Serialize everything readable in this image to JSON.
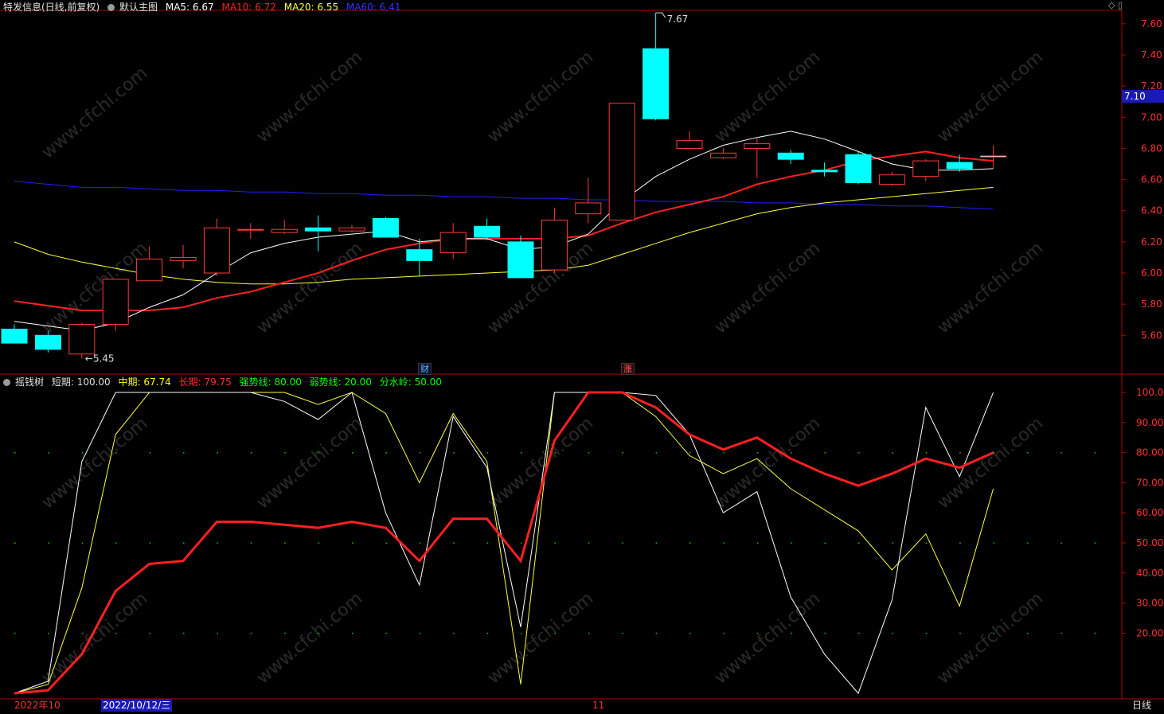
{
  "header": {
    "stock_title": "特发信息(日线,前复权)",
    "template": "默认主图",
    "ma5": "MA5: 6.67",
    "ma10": "MA10: 6.72",
    "ma20": "MA20: 6.55",
    "ma60": "MA60: 6.41"
  },
  "indicator_header": {
    "name": "摇钱树",
    "short": "短期: 100.00",
    "mid": "中期: 67.74",
    "long": "长期: 79.75",
    "strong": "强势线: 80.00",
    "weak": "弱势线: 20.00",
    "watershed": "分水岭: 50.00"
  },
  "annotations": {
    "high_label": "7.67",
    "low_label": "←5.45",
    "cai_tag": "财",
    "zhang_tag": "涨",
    "current_price": "7.10"
  },
  "bottom_axis": {
    "month_label": "2022年10",
    "cursor_date": "2022/10/12/三",
    "nov_label": "11",
    "period": "日线"
  },
  "colors": {
    "up": "#ff3b3b",
    "down": "#00ffff",
    "ma5": "#ffffff",
    "ma10": "#ff2020",
    "ma20": "#ffff40",
    "ma60": "#2020ff",
    "axis_red": "#b00000",
    "mid_label": "#ffff00",
    "long_label": "#ff3030",
    "strong_label": "#00ff00",
    "weak_label": "#00ff00",
    "watershed_label": "#00ff00"
  },
  "chart_data": [
    {
      "type": "candlestick",
      "title": "特发信息(日线,前复权)",
      "y_ticks": [
        5.6,
        5.8,
        6.0,
        6.2,
        6.4,
        6.6,
        6.8,
        7.0,
        7.2,
        7.4,
        7.6
      ],
      "ylim": [
        5.45,
        7.67
      ],
      "candles": [
        {
          "o": 5.64,
          "c": 5.55,
          "h": 5.67,
          "l": 5.55
        },
        {
          "o": 5.6,
          "c": 5.51,
          "h": 5.63,
          "l": 5.49
        },
        {
          "o": 5.48,
          "c": 5.67,
          "h": 5.68,
          "l": 5.45
        },
        {
          "o": 5.67,
          "c": 5.96,
          "h": 5.96,
          "l": 5.63
        },
        {
          "o": 5.95,
          "c": 6.09,
          "h": 6.17,
          "l": 5.95
        },
        {
          "o": 6.08,
          "c": 6.1,
          "h": 6.18,
          "l": 6.03
        },
        {
          "o": 6.0,
          "c": 6.29,
          "h": 6.35,
          "l": 5.98
        },
        {
          "o": 6.28,
          "c": 6.28,
          "h": 6.32,
          "l": 6.22
        },
        {
          "o": 6.26,
          "c": 6.28,
          "h": 6.34,
          "l": 6.25
        },
        {
          "o": 6.29,
          "c": 6.27,
          "h": 6.37,
          "l": 6.14
        },
        {
          "o": 6.27,
          "c": 6.29,
          "h": 6.31,
          "l": 6.26
        },
        {
          "o": 6.35,
          "c": 6.23,
          "h": 6.36,
          "l": 6.23
        },
        {
          "o": 6.15,
          "c": 6.08,
          "h": 6.22,
          "l": 5.98
        },
        {
          "o": 6.13,
          "c": 6.26,
          "h": 6.32,
          "l": 6.09
        },
        {
          "o": 6.3,
          "c": 6.23,
          "h": 6.35,
          "l": 6.21
        },
        {
          "o": 6.2,
          "c": 5.97,
          "h": 6.24,
          "l": 5.97
        },
        {
          "o": 6.02,
          "c": 6.34,
          "h": 6.42,
          "l": 6.0
        },
        {
          "o": 6.38,
          "c": 6.45,
          "h": 6.61,
          "l": 6.32
        },
        {
          "o": 6.34,
          "c": 7.09,
          "h": 7.09,
          "l": 6.34
        },
        {
          "o": 7.44,
          "c": 6.99,
          "h": 7.67,
          "l": 6.98
        },
        {
          "o": 6.8,
          "c": 6.85,
          "h": 6.91,
          "l": 6.8
        },
        {
          "o": 6.74,
          "c": 6.77,
          "h": 6.8,
          "l": 6.73
        },
        {
          "o": 6.8,
          "c": 6.83,
          "h": 6.87,
          "l": 6.61
        },
        {
          "o": 6.77,
          "c": 6.73,
          "h": 6.79,
          "l": 6.7
        },
        {
          "o": 6.66,
          "c": 6.65,
          "h": 6.71,
          "l": 6.62
        },
        {
          "o": 6.76,
          "c": 6.58,
          "h": 6.78,
          "l": 6.57
        },
        {
          "o": 6.57,
          "c": 6.63,
          "h": 6.65,
          "l": 6.56
        },
        {
          "o": 6.62,
          "c": 6.72,
          "h": 6.73,
          "l": 6.59
        },
        {
          "o": 6.71,
          "c": 6.67,
          "h": 6.76,
          "l": 6.65
        },
        {
          "o": 6.75,
          "c": 6.75,
          "h": 6.82,
          "l": 6.67
        }
      ],
      "ma5": [
        5.69,
        null,
        5.63,
        5.68,
        5.78,
        5.86,
        6.0,
        6.13,
        6.19,
        6.23,
        6.25,
        6.27,
        6.2,
        6.22,
        6.22,
        6.15,
        6.17,
        6.25,
        6.46,
        6.62,
        6.73,
        6.82,
        6.87,
        6.91,
        6.86,
        6.78,
        6.7,
        6.66,
        6.66,
        6.67
      ],
      "ma10": [
        5.82,
        5.79,
        5.76,
        5.76,
        5.76,
        5.78,
        5.84,
        5.88,
        5.94,
        6.0,
        6.08,
        6.15,
        6.19,
        6.22,
        6.22,
        6.22,
        6.22,
        6.24,
        6.32,
        6.39,
        6.44,
        6.49,
        6.57,
        6.62,
        6.66,
        6.72,
        6.75,
        6.78,
        6.74,
        6.72
      ],
      "ma20": [
        6.2,
        6.12,
        6.07,
        6.03,
        5.99,
        5.96,
        5.94,
        5.93,
        5.93,
        5.94,
        5.96,
        5.97,
        5.98,
        5.99,
        6.0,
        6.01,
        6.02,
        6.05,
        6.12,
        6.19,
        6.26,
        6.32,
        6.38,
        6.42,
        6.45,
        6.47,
        6.49,
        6.51,
        6.53,
        6.55
      ],
      "ma60": [
        6.59,
        6.57,
        6.55,
        6.55,
        6.54,
        6.53,
        6.53,
        6.52,
        6.52,
        6.51,
        6.51,
        6.5,
        6.5,
        6.49,
        6.49,
        6.48,
        6.48,
        6.47,
        6.47,
        6.46,
        6.46,
        6.46,
        6.45,
        6.45,
        6.44,
        6.44,
        6.43,
        6.43,
        6.42,
        6.41
      ]
    },
    {
      "type": "line",
      "title": "摇钱树",
      "y_ticks": [
        20,
        30,
        40,
        50,
        60,
        70,
        80,
        90,
        100
      ],
      "ylim": [
        0,
        100
      ],
      "guides": [
        80,
        50,
        20
      ],
      "series": [
        {
          "name": "短期",
          "values": [
            0,
            4,
            77,
            100,
            100,
            100,
            100,
            100,
            97,
            91,
            100,
            60,
            36,
            92,
            75,
            22,
            100,
            100,
            100,
            99,
            86,
            60,
            67,
            32,
            13,
            0,
            31,
            95,
            72,
            100
          ]
        },
        {
          "name": "中期",
          "values": [
            0,
            3,
            35,
            86,
            100,
            100,
            100,
            100,
            100,
            96,
            100,
            93,
            70,
            93,
            77,
            3,
            100,
            100,
            100,
            92,
            79,
            73,
            78,
            68,
            61,
            54,
            41,
            53,
            29,
            68
          ]
        },
        {
          "name": "长期",
          "values": [
            0,
            1,
            13,
            34,
            43,
            44,
            57,
            57,
            56,
            55,
            57,
            55,
            44,
            58,
            58,
            44,
            84,
            100,
            100,
            95,
            86,
            81,
            85,
            78,
            73,
            69,
            73,
            78,
            75,
            80
          ]
        }
      ]
    }
  ]
}
